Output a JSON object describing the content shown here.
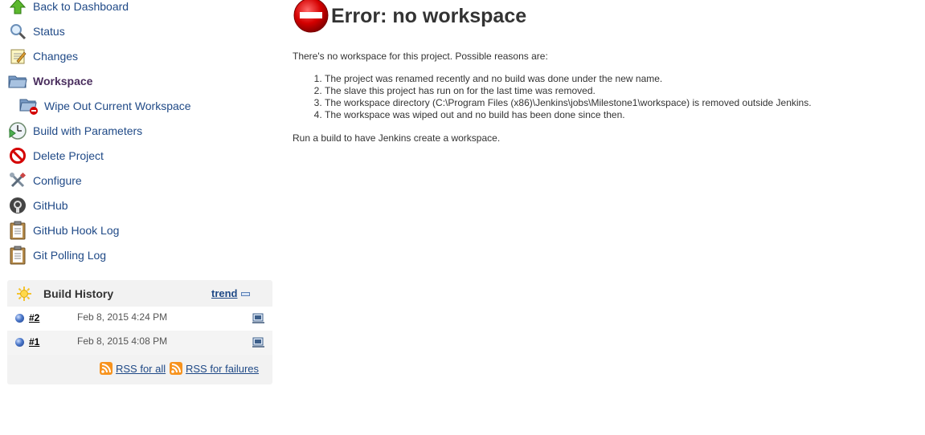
{
  "sidebar": {
    "items": [
      {
        "label": "Back to Dashboard",
        "icon": "up-arrow-icon"
      },
      {
        "label": "Status",
        "icon": "magnifier-icon"
      },
      {
        "label": "Changes",
        "icon": "notepad-icon"
      },
      {
        "label": "Workspace",
        "icon": "folder-icon"
      },
      {
        "label": "Wipe Out Current Workspace",
        "icon": "folder-delete-icon"
      },
      {
        "label": "Build with Parameters",
        "icon": "clock-play-icon"
      },
      {
        "label": "Delete Project",
        "icon": "no-entry-icon"
      },
      {
        "label": "Configure",
        "icon": "wrench-screwdriver-icon"
      },
      {
        "label": "GitHub",
        "icon": "github-icon"
      },
      {
        "label": "GitHub Hook Log",
        "icon": "clipboard-icon"
      },
      {
        "label": "Git Polling Log",
        "icon": "clipboard-icon"
      }
    ]
  },
  "build_history": {
    "title": "Build History",
    "trend_label": "trend",
    "builds": [
      {
        "number": "#2",
        "date": "Feb 8, 2015 4:24 PM"
      },
      {
        "number": "#1",
        "date": "Feb 8, 2015 4:08 PM"
      }
    ],
    "rss_all": "RSS for all",
    "rss_failures": "RSS for failures"
  },
  "main": {
    "title": "Error: no workspace",
    "intro": "There's no workspace for this project. Possible reasons are:",
    "reasons": [
      "The project was renamed recently and no build was done under the new name.",
      "The slave this project has run on for the last time was removed.",
      "The workspace directory (C:\\Program Files (x86)\\Jenkins\\jobs\\Milestone1\\workspace) is removed outside Jenkins.",
      "The workspace was wiped out and no build has been done since then."
    ],
    "footer": "Run a build to have Jenkins create a workspace."
  },
  "colors": {
    "link": "#204a87",
    "active": "#4a2e5e",
    "error_red": "#d40000",
    "panel_bg": "#f2f2f2"
  }
}
